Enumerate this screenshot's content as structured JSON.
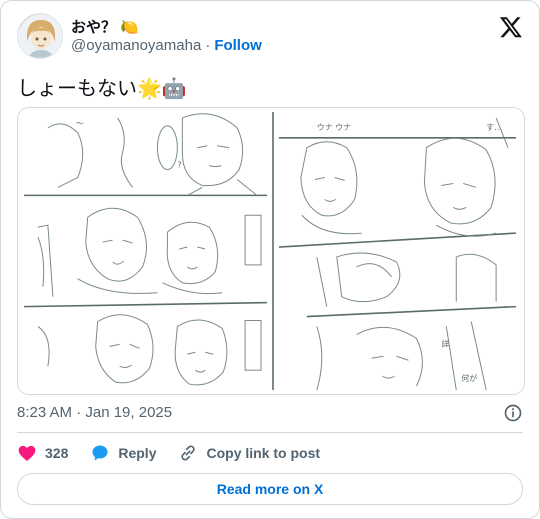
{
  "user": {
    "name": "おや？",
    "name_emoji": "🍋",
    "handle": "@oyamanoyamaha",
    "separator": "·",
    "follow_label": "Follow"
  },
  "tweet": {
    "text": "しょーもない🌟🤖",
    "timestamp": "8:23 AM · Jan 19, 2025"
  },
  "actions": {
    "likes": "328",
    "reply_label": "Reply",
    "copy_label": "Copy link to post"
  },
  "footer": {
    "read_more_label": "Read more on X"
  },
  "colors": {
    "accent": "#006fd6",
    "like": "#f91880",
    "reply_icon": "#1d9bf0",
    "muted": "#536471",
    "border": "#cfd9de"
  },
  "icons": [
    "x-logo-icon",
    "heart-icon",
    "reply-bubble-icon",
    "link-icon",
    "info-icon"
  ]
}
